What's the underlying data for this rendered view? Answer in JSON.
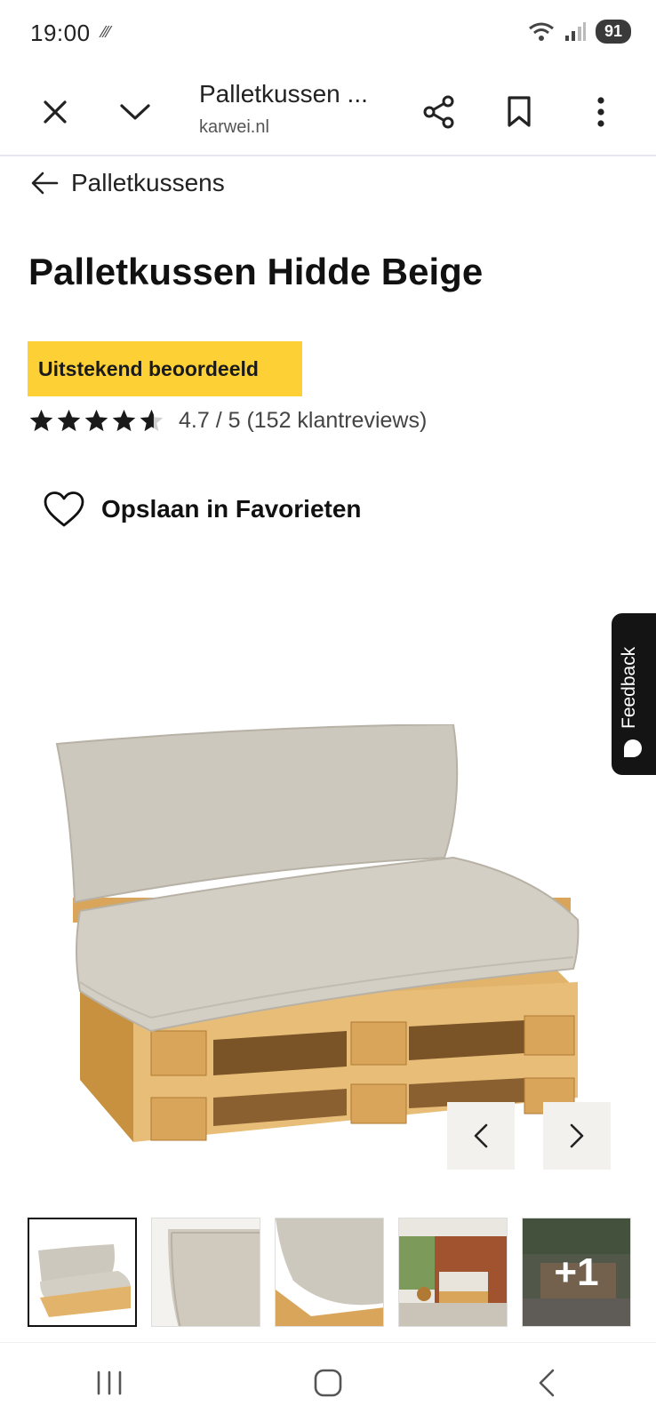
{
  "status_bar": {
    "time": "19:00",
    "battery": "91"
  },
  "browser": {
    "title": "Palletkussen ...",
    "url": "karwei.nl"
  },
  "breadcrumb": {
    "label": "Palletkussens"
  },
  "product": {
    "title": "Palletkussen Hidde Beige",
    "badge": "Uitstekend beoordeeld",
    "rating_value": 4.7,
    "rating_text": "4.7 / 5 (152 klantreviews)",
    "favorite_label": "Opslaan in Favorieten"
  },
  "feedback": {
    "label": "Feedback"
  },
  "gallery": {
    "thumbnails": [
      "main",
      "detail-corner",
      "detail-cushion",
      "lifestyle-terrace",
      "lifestyle-more"
    ],
    "more_label": "+1"
  },
  "colors": {
    "badge": "#fdd135",
    "accent": "#111111"
  }
}
